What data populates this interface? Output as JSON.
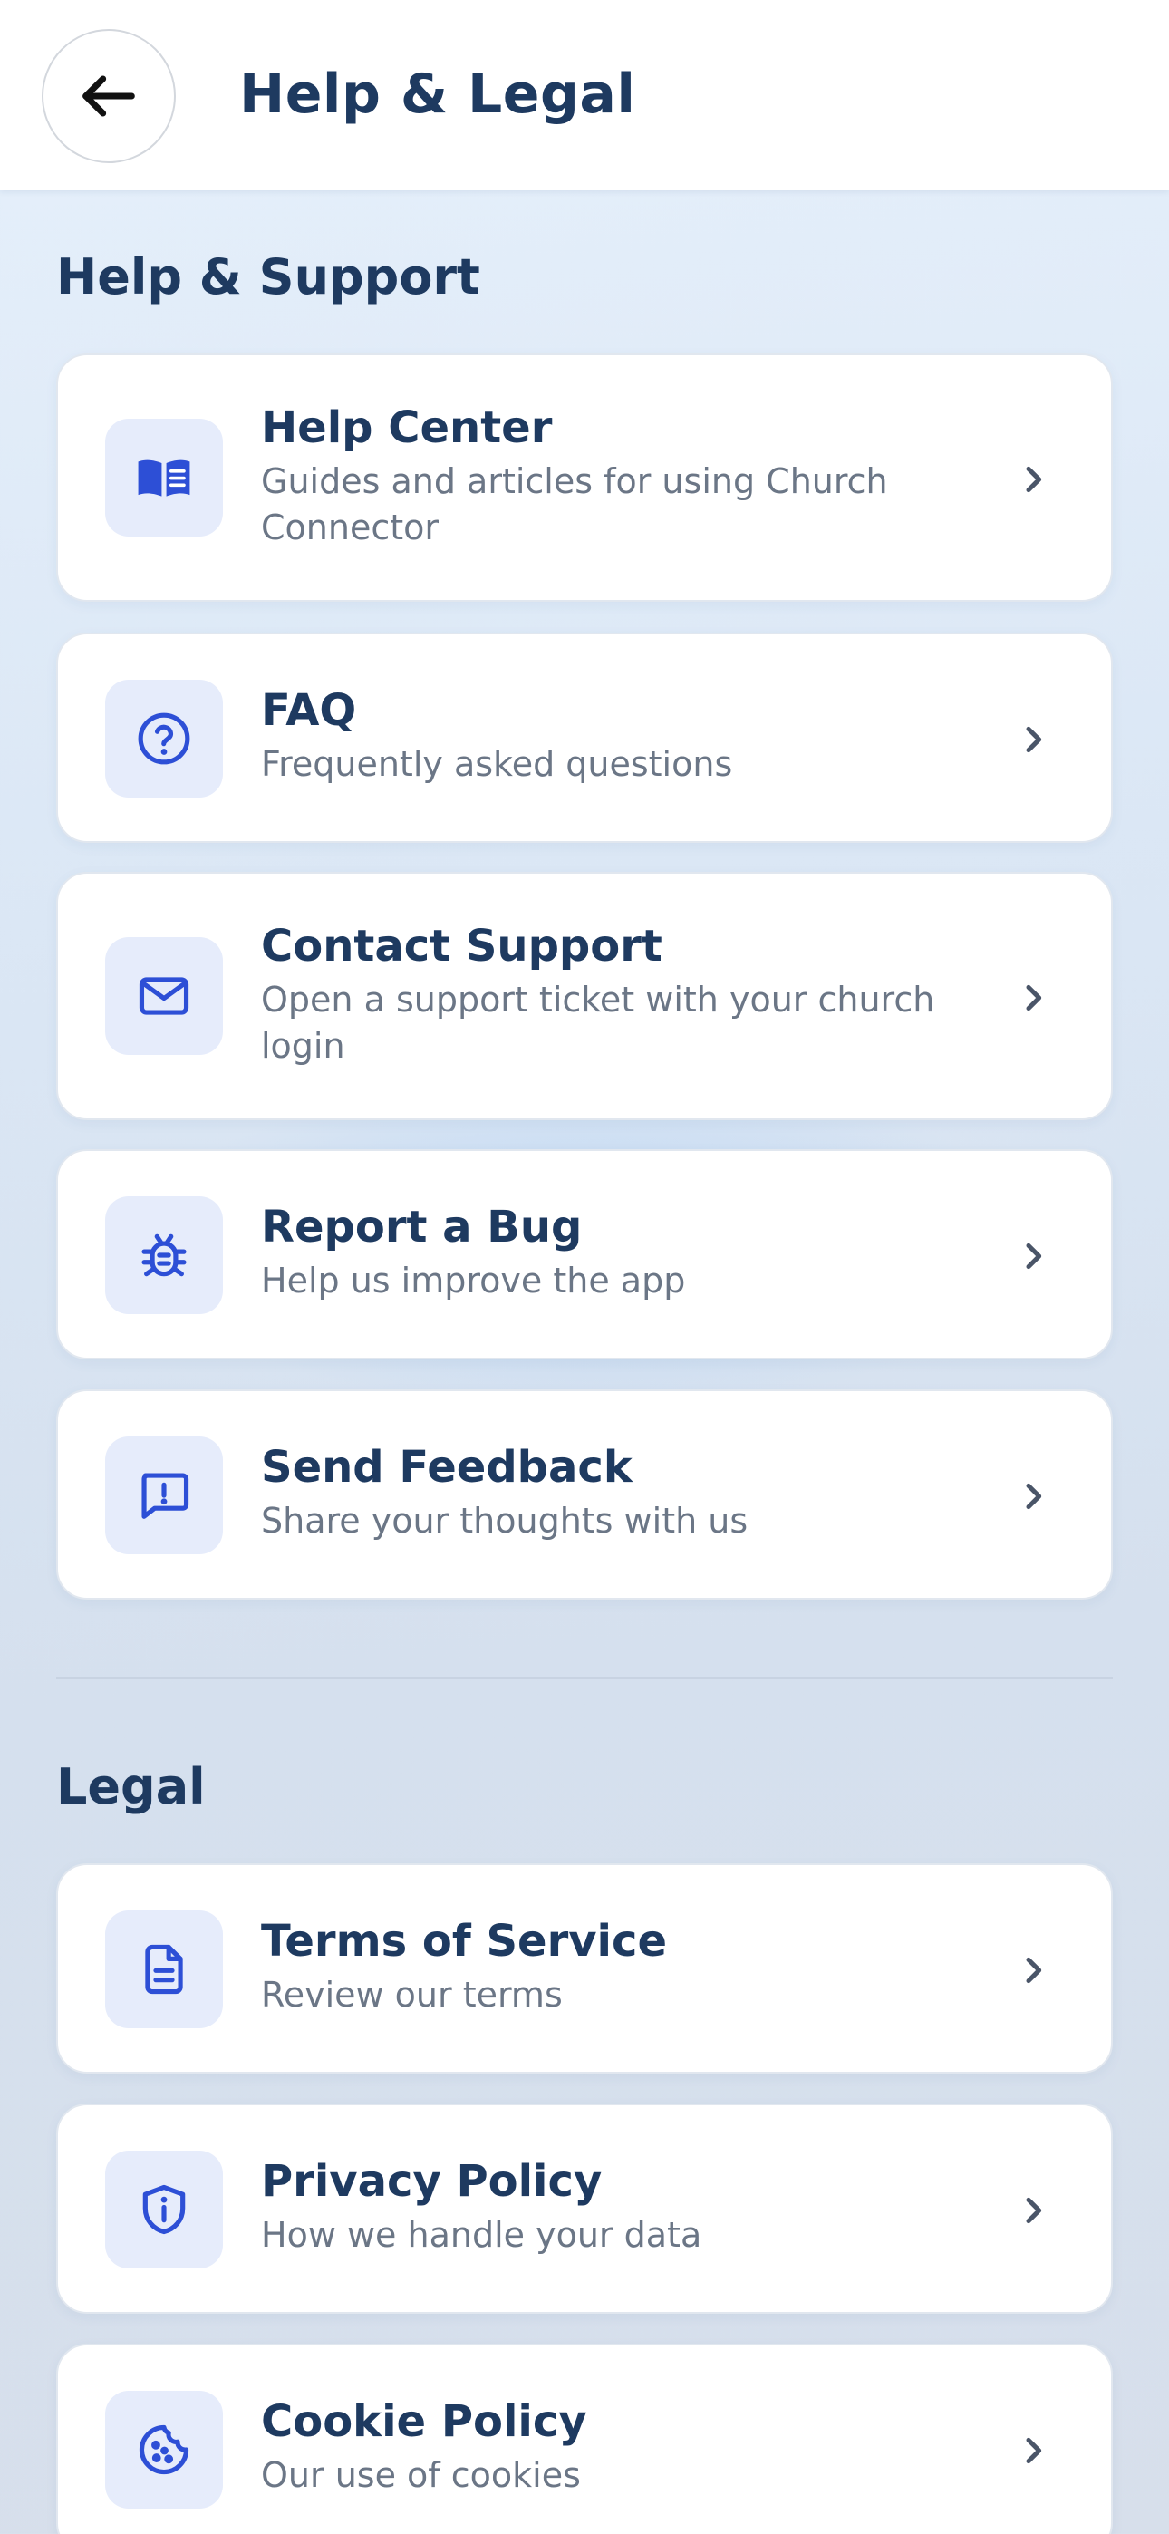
{
  "header": {
    "title": "Help & Legal",
    "back_icon": "arrow-left-icon"
  },
  "help_support": {
    "title": "Help & Support",
    "items": [
      {
        "title": "Help Center",
        "subtitle": "Guides and articles for using Church Connector",
        "icon": "book-open-icon"
      },
      {
        "title": "FAQ",
        "subtitle": "Frequently asked questions",
        "icon": "question-circle-icon"
      },
      {
        "title": "Contact Support",
        "subtitle": "Open a support ticket with your church login",
        "icon": "envelope-icon"
      },
      {
        "title": "Report a Bug",
        "subtitle": "Help us improve the app",
        "icon": "bug-icon"
      },
      {
        "title": "Send Feedback",
        "subtitle": "Share your thoughts with us",
        "icon": "feedback-icon"
      }
    ]
  },
  "legal": {
    "title": "Legal",
    "items": [
      {
        "title": "Terms of Service",
        "subtitle": "Review our terms",
        "icon": "document-icon"
      },
      {
        "title": "Privacy Policy",
        "subtitle": "How we handle your data",
        "icon": "shield-info-icon"
      },
      {
        "title": "Cookie Policy",
        "subtitle": "Our use of cookies",
        "icon": "cookie-icon"
      }
    ]
  },
  "colors": {
    "accent": "#2d4fd6",
    "title": "#1e3a60",
    "subtitle": "#6b7686",
    "icon_bg": "#e6ecfb"
  }
}
